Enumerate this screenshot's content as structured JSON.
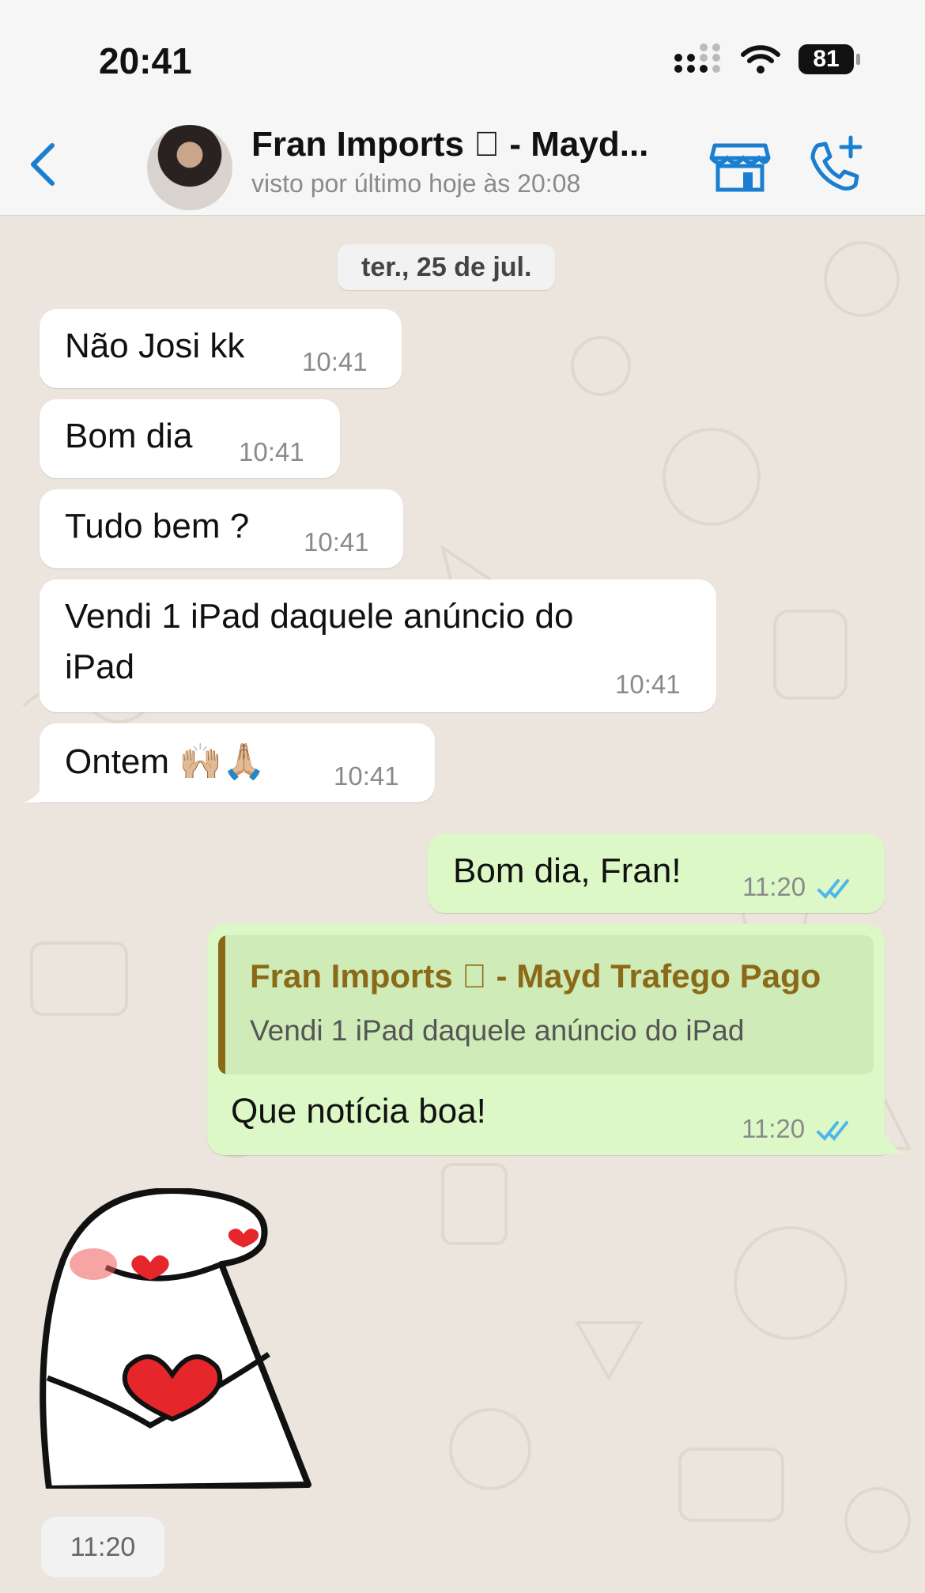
{
  "status_bar": {
    "time": "20:41",
    "battery": "81"
  },
  "header": {
    "title": "Fran Imports  - Mayd...",
    "subtitle": "visto por último hoje às 20:08"
  },
  "date_chip": "ter., 25 de jul.",
  "messages": [
    {
      "text": "Não Josi kk",
      "time": "10:41"
    },
    {
      "text": "Bom dia",
      "time": "10:41"
    },
    {
      "text": "Tudo bem ?",
      "time": "10:41"
    },
    {
      "line1": "Vendi 1 iPad daquele anúncio do",
      "line2": "iPad",
      "time": "10:41"
    },
    {
      "text": "Ontem 🙌🏼🙏🏼",
      "time": "10:41"
    },
    {
      "text": "Bom dia, Fran!",
      "time": "11:20"
    },
    {
      "quote_name": "Fran Imports  - Mayd Trafego Pago",
      "quote_text": "Vendi 1 iPad daquele anúncio do iPad",
      "text": "Que notícia boa!",
      "time": "11:20"
    }
  ],
  "sticker": {
    "time": "11:20"
  },
  "colors": {
    "chat_background": "#ECE5DD",
    "incoming_bubble": "#FFFFFF",
    "outgoing_bubble": "#DCF8C6",
    "accent_blue": "#1A7FD1",
    "read_ticks": "#4FB6EC",
    "quote_name": "#8A6A16"
  }
}
